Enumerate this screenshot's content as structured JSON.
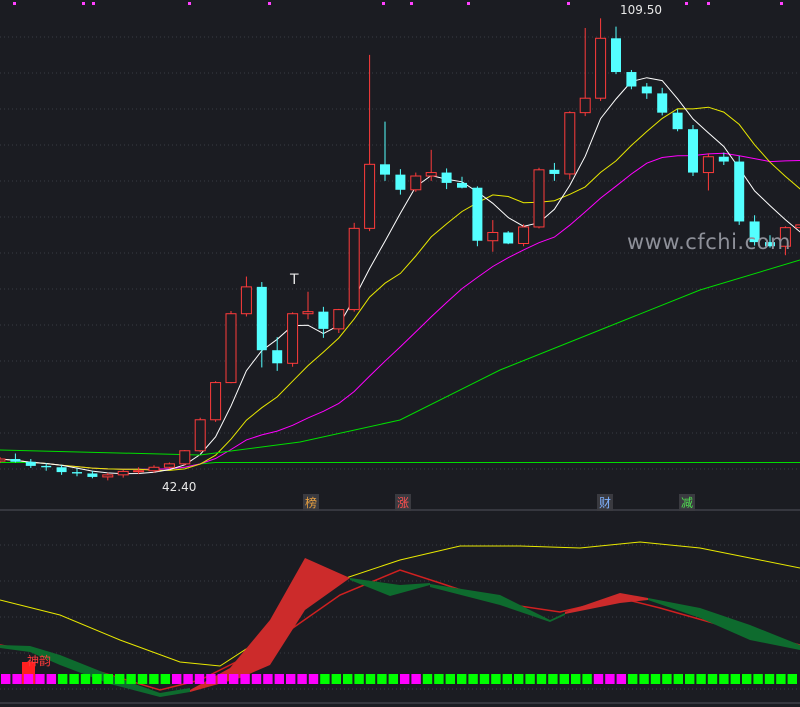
{
  "watermark": "www.cfchi.com",
  "price_high_label": "109.50",
  "price_low_label": "42.40",
  "t_marker": "T",
  "signal_label": "神韵",
  "event_tags": [
    {
      "text": "榜",
      "color": "#e8a040"
    },
    {
      "text": "涨",
      "color": "#ff5050"
    },
    {
      "text": "财",
      "color": "#7fb2ff"
    },
    {
      "text": "减",
      "color": "#50e050"
    }
  ],
  "colors": {
    "up": "#ff3b3b",
    "down": "#54ffff",
    "ma5": "#ffffff",
    "ma10": "#e8e800",
    "ma20": "#ff00ff",
    "ma60": "#00dd00",
    "grid": "#3a3b44",
    "hist_pos": "#cc2b2b",
    "hist_neg": "#0e6b2e",
    "bar_a": "#ff00ff",
    "bar_b": "#00ff00"
  },
  "chart_data": {
    "type": "candlestick",
    "high": 109.5,
    "low": 42.4,
    "candles": [
      [
        45.2,
        45.8,
        44.9,
        45.5
      ],
      [
        45.5,
        46.3,
        45.0,
        45.1
      ],
      [
        45.1,
        45.5,
        44.2,
        44.5
      ],
      [
        44.5,
        44.9,
        43.8,
        44.3
      ],
      [
        44.3,
        44.6,
        43.2,
        43.6
      ],
      [
        43.6,
        44.1,
        43.0,
        43.4
      ],
      [
        43.4,
        43.8,
        42.7,
        42.9
      ],
      [
        42.9,
        43.5,
        42.4,
        43.2
      ],
      [
        43.2,
        43.9,
        42.8,
        43.7
      ],
      [
        43.7,
        44.3,
        43.3,
        43.8
      ],
      [
        43.8,
        44.6,
        43.5,
        44.3
      ],
      [
        44.3,
        45.0,
        44.0,
        44.8
      ],
      [
        44.8,
        46.8,
        44.6,
        46.7
      ],
      [
        46.7,
        51.5,
        46.5,
        51.2
      ],
      [
        51.2,
        56.8,
        50.9,
        56.6
      ],
      [
        56.6,
        67.0,
        56.5,
        66.6
      ],
      [
        66.6,
        72.0,
        66.2,
        70.5
      ],
      [
        70.5,
        71.2,
        58.8,
        61.3
      ],
      [
        61.3,
        63.2,
        58.3,
        59.4
      ],
      [
        59.4,
        66.8,
        58.9,
        66.6
      ],
      [
        66.6,
        69.8,
        65.8,
        66.9
      ],
      [
        66.9,
        67.6,
        63.1,
        64.4
      ],
      [
        64.4,
        67.3,
        63.8,
        67.2
      ],
      [
        67.2,
        79.8,
        66.9,
        79.0
      ],
      [
        79.0,
        104.2,
        78.6,
        88.3
      ],
      [
        88.3,
        94.5,
        85.9,
        86.8
      ],
      [
        86.8,
        87.6,
        83.9,
        84.6
      ],
      [
        84.6,
        87.1,
        84.3,
        86.6
      ],
      [
        86.6,
        90.4,
        85.9,
        87.1
      ],
      [
        87.1,
        87.7,
        84.7,
        85.6
      ],
      [
        85.6,
        86.5,
        84.8,
        84.9
      ],
      [
        84.9,
        85.1,
        76.4,
        77.2
      ],
      [
        77.2,
        80.2,
        75.6,
        78.4
      ],
      [
        78.4,
        78.6,
        76.7,
        76.8
      ],
      [
        76.8,
        79.6,
        76.4,
        79.2
      ],
      [
        79.2,
        87.8,
        79.0,
        87.5
      ],
      [
        87.5,
        88.5,
        85.9,
        86.9
      ],
      [
        86.9,
        96.0,
        86.1,
        95.8
      ],
      [
        95.8,
        108.1,
        95.3,
        97.9
      ],
      [
        97.9,
        109.5,
        97.5,
        106.6
      ],
      [
        106.6,
        108.3,
        101.4,
        101.7
      ],
      [
        101.7,
        102.0,
        99.2,
        99.6
      ],
      [
        99.6,
        100.1,
        97.8,
        98.6
      ],
      [
        98.6,
        99.4,
        95.4,
        95.8
      ],
      [
        95.8,
        96.3,
        93.1,
        93.4
      ],
      [
        93.4,
        94.0,
        86.6,
        87.1
      ],
      [
        87.1,
        89.9,
        84.5,
        89.4
      ],
      [
        89.4,
        90.0,
        88.2,
        88.7
      ],
      [
        88.7,
        89.5,
        79.5,
        80.0
      ],
      [
        80.0,
        80.9,
        76.5,
        77.0
      ],
      [
        77.0,
        78.0,
        76.2,
        76.4
      ],
      [
        76.4,
        79.3,
        75.1,
        79.1
      ],
      [
        79.1,
        81.3,
        78.2,
        79.5
      ]
    ]
  }
}
